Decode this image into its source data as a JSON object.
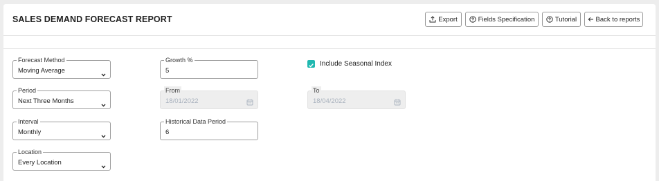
{
  "header": {
    "title": "SALES DEMAND FORECAST REPORT",
    "buttons": {
      "export": "Export",
      "fields_spec": "Fields Specification",
      "tutorial": "Tutorial",
      "back": "Back to reports"
    }
  },
  "form": {
    "forecast_method": {
      "label": "Forecast Method",
      "value": "Moving Average"
    },
    "growth": {
      "label": "Growth %",
      "value": "5"
    },
    "include_seasonal": {
      "label": "Include Seasonal Index",
      "checked": true
    },
    "period": {
      "label": "Period",
      "value": "Next Three Months"
    },
    "from": {
      "label": "From",
      "value": "18/01/2022"
    },
    "to": {
      "label": "To",
      "value": "18/04/2022"
    },
    "interval": {
      "label": "Interval",
      "value": "Monthly"
    },
    "historical": {
      "label": "Historical Data Period",
      "value": "6"
    },
    "location": {
      "label": "Location",
      "value": "Every Location"
    }
  },
  "colors": {
    "accent": "#20b8b0",
    "border": "#9d9d9d",
    "disabled_bg": "#eeeeee"
  }
}
